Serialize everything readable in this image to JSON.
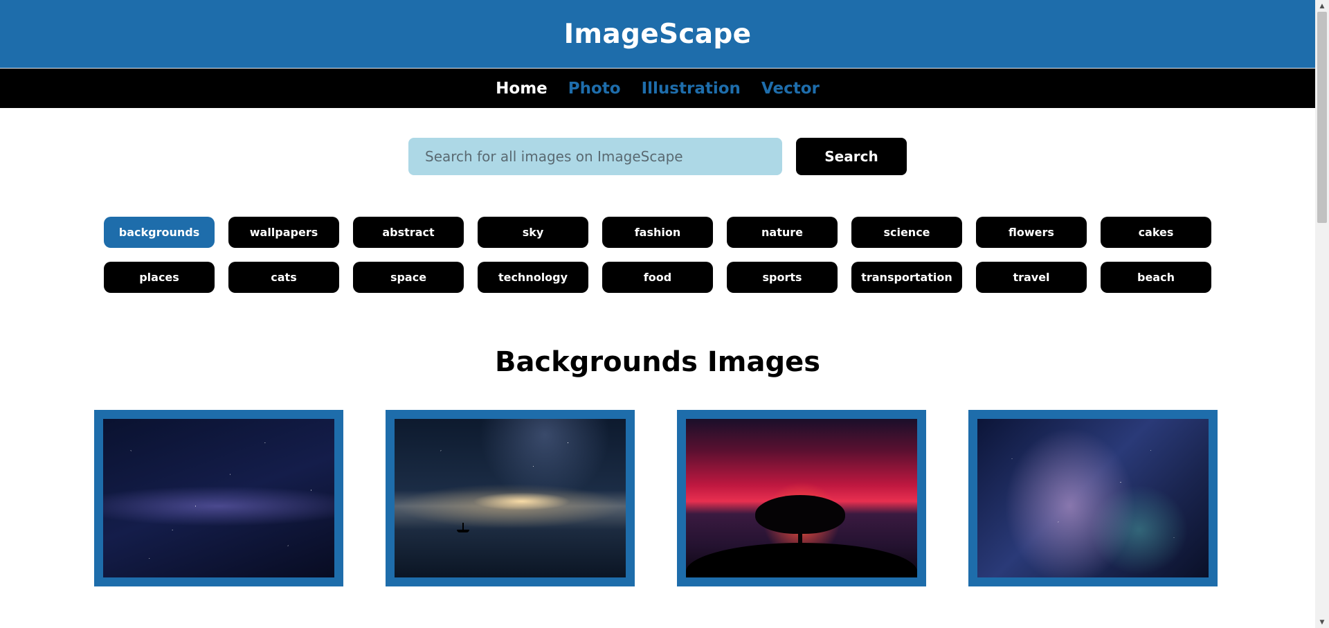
{
  "header": {
    "title": "ImageScape"
  },
  "nav": {
    "items": [
      {
        "label": "Home"
      },
      {
        "label": "Photo"
      },
      {
        "label": "Illustration"
      },
      {
        "label": "Vector"
      }
    ]
  },
  "search": {
    "placeholder": "Search for all images on ImageScape",
    "value": "",
    "button_label": "Search"
  },
  "categories": {
    "row1": [
      "backgrounds",
      "wallpapers",
      "abstract",
      "sky",
      "fashion",
      "nature",
      "science",
      "flowers",
      "cakes"
    ],
    "row2": [
      "places",
      "cats",
      "space",
      "technology",
      "food",
      "sports",
      "transportation",
      "travel",
      "beach"
    ],
    "active": "backgrounds"
  },
  "section": {
    "title": "Backgrounds Images"
  },
  "colors": {
    "brand": "#1e6dab",
    "nav_bg": "#000000",
    "search_bg": "#add8e6",
    "chip_bg": "#000000",
    "chip_active": "#1e6dab"
  },
  "icons": {
    "scroll_up": "scroll-up-arrow-icon",
    "scroll_down": "scroll-down-arrow-icon"
  }
}
